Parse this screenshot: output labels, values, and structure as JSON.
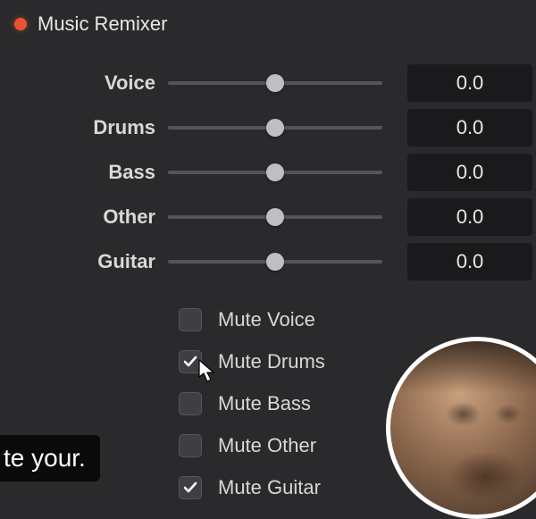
{
  "header": {
    "title": "Music Remixer"
  },
  "sliders": [
    {
      "label": "Voice",
      "value": "0.0",
      "pos": 50
    },
    {
      "label": "Drums",
      "value": "0.0",
      "pos": 50
    },
    {
      "label": "Bass",
      "value": "0.0",
      "pos": 50
    },
    {
      "label": "Other",
      "value": "0.0",
      "pos": 50
    },
    {
      "label": "Guitar",
      "value": "0.0",
      "pos": 50
    }
  ],
  "checks": [
    {
      "label": "Mute Voice",
      "checked": false
    },
    {
      "label": "Mute Drums",
      "checked": true
    },
    {
      "label": "Mute Bass",
      "checked": false
    },
    {
      "label": "Mute Other",
      "checked": false
    },
    {
      "label": "Mute Guitar",
      "checked": true
    }
  ],
  "caption": "te your."
}
